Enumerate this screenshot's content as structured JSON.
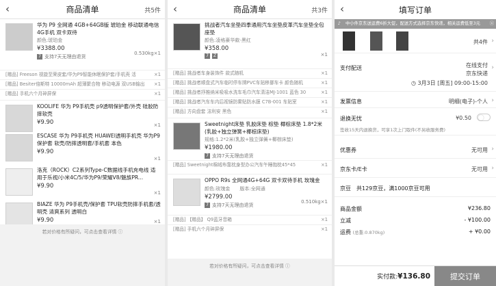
{
  "p1": {
    "title": "商品清单",
    "count": "共5件",
    "item1": {
      "name": "华为 P9 全网通 4GB+64GB版 琥珀金 移动联通电信4G手机 双卡双待",
      "attr": "颜色:琥珀金",
      "price": "¥3388.00",
      "weight": "0.530kg×1",
      "service": "支持7天无理由退货"
    },
    "gifts": [
      {
        "t": "[赠品] Freeson 视旋至荣皮套/华为P9智能休眠保护套/手机壳 活",
        "q": "×1"
      },
      {
        "t": "[赠品] Besiter倍斯特 10000mAh 超薄聚合物 移动电源 双USB输出",
        "q": "×1"
      },
      {
        "t": "[赠品] 手机六个月碎屏保",
        "q": "×1"
      }
    ],
    "item2": {
      "name": "KOOLIFE 华为 P9手机壳 p9透明保护套/外壳 硅胶防摔软壳",
      "price": "¥9.90",
      "qty": "×1"
    },
    "item3": {
      "name": "ESCASE 华为 P9手机壳 HUAWEI透明手机壳 华为P9保护套 软壳/防摔透明套/手机套 本色",
      "price": "¥9.90",
      "qty": "×1"
    },
    "item4": {
      "name": "洛克（ROCK）C2系列Type-C数据线手机充电线 适用于乐视/小米4C/5/华为P9/荣耀V8/魅族PR...",
      "price": "¥9.90",
      "qty": "×1"
    },
    "item5": {
      "name": "BIAZE 华为 P9手机壳/保护套 TPU软壳防摔手机套/透明壳 清爽系列 透明白",
      "price": "¥9.90",
      "qty": "×1"
    },
    "footer": "若对价格有所疑问，可点击查看详情"
  },
  "p2": {
    "title": "商品清单",
    "count": "共3件",
    "item1": {
      "name": "挑战者汽车坐垫四季通用汽车坐垫皮革汽车坐垫全包座垫",
      "attr": "颜色:凌格豪华款-黑红",
      "price": "¥358.00",
      "qty": "×1"
    },
    "gifts": [
      {
        "t": "[赠品] 挑战者车身装饰件 款式随机",
        "q": "×1"
      },
      {
        "t": "[赠品] 挑战者顺盘式汽车临时停车牌PVC车贴移挪车卡 颜色随机",
        "q": "×1"
      },
      {
        "t": "[赠品] 挑战者抒推纳米吸吸水洗车毛巾汽车清洁MJ-1001 蓝色 30",
        "q": "×1"
      },
      {
        "t": "[赠品] 挑战者汽车车内后视镜防雾贴防水膜 C7B-001 车贴室",
        "q": "×1"
      },
      {
        "t": "[赠品] 方向盘套 法利安 黑色",
        "q": "×1"
      }
    ],
    "item2": {
      "name": "Sweetnight床垫 乳胶床垫 棕垫 椰棕床垫 1.8*2米 (乳胶+独立弹簧+椰棕床垫)",
      "attr": "规格:1.2*2米(乳胶+独立弹簧+椰棕床垫)",
      "price": "¥1980.00",
      "service": "支持7天无理由退货"
    },
    "gift2": {
      "t": "[赠品] Sweetnight棉绒布靠枕身型办公汽车午睡抱枕45*45",
      "q": "×1"
    },
    "item3": {
      "name": "OPPO R9s 全网通4G+64G 双卡双待手机 玫瑰金",
      "attr": "颜色:玫瑰金",
      "attr2": "版本:全网通",
      "price": "¥2799.00",
      "weight": "0.510kg×1",
      "service": "支持7天无理由退货"
    },
    "gifts3": [
      {
        "t": "[赠品] 【赠品】 Q9蓝牙音箱",
        "q": "×1"
      },
      {
        "t": "[赠品] 手机六个月碎屏保",
        "q": "×1"
      }
    ],
    "footer": "若对价格有所疑问，可点击查看详情"
  },
  "p3": {
    "title": "填写订单",
    "notice": "中小件京东送运费6折大促，配送方式选择京东快递，相关运费低至3元",
    "count": "共4件",
    "delivery": {
      "label": "支付配送",
      "pay": "在线支付",
      "express": "京东快递",
      "time": "3月3日 [周五] 09:00-15:00"
    },
    "invoice": {
      "label": "发票信息",
      "value": "明细(电子)-个人"
    },
    "insurance": {
      "label": "退换无忧",
      "value": "¥0.50",
      "desc": "签收15天内退换货，可享1次上门取件(不另收服务费)"
    },
    "coupon": {
      "label": "优惠券",
      "value": "无可用"
    },
    "card": {
      "label": "京东卡/E卡",
      "value": "无可用"
    },
    "bean": {
      "label": "京豆",
      "desc": "共129京豆，满1000京豆可用"
    },
    "amount": {
      "label": "商品金额",
      "value": "¥236.80"
    },
    "discount": {
      "label": "立减",
      "value": "- ¥100.00"
    },
    "freight": {
      "label": "运费",
      "weight": "(总重:0.870kg)",
      "value": "+ ¥0.00"
    },
    "paid_label": "实付款:",
    "paid_value": "¥136.80",
    "submit": "提交订单"
  }
}
